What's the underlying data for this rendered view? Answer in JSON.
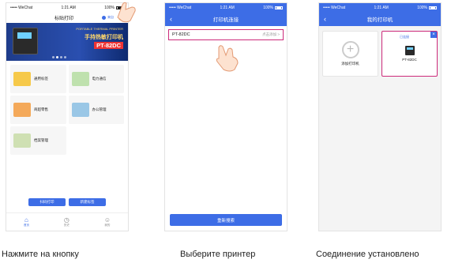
{
  "screen1": {
    "status": {
      "carrier": "••••• WeChat",
      "time": "1:21 AM",
      "battery": "100%"
    },
    "nav_title": "标贴打印",
    "nav_right": "来自",
    "banner": {
      "line1": "PORTABLE THERMAL PRINTER",
      "line2": "手持热敏打印机",
      "model": "PT-82DC"
    },
    "tiles": [
      {
        "label": "通用标签",
        "color": "#f6c94a"
      },
      {
        "label": "电力通信",
        "color": "#bfe1ae"
      },
      {
        "label": "商超零售",
        "color": "#f4a95a"
      },
      {
        "label": "办公管理",
        "color": "#9ac7e6"
      },
      {
        "label": "档案管理",
        "color": "#cfe0b3"
      }
    ],
    "quick": [
      "扫码打印",
      "新建标签"
    ],
    "tabs": [
      {
        "label": "首页",
        "icon": "house-icon"
      },
      {
        "label": "历史",
        "icon": "clock-icon"
      },
      {
        "label": "我的",
        "icon": "user-icon"
      }
    ]
  },
  "screen2": {
    "status": {
      "carrier": "••••• WeChat",
      "time": "1:21 AM",
      "battery": "100%"
    },
    "nav_title": "打印机连接",
    "printer_name": "PT-82DC",
    "printer_hint": "点击添加 >",
    "rescan": "重新搜索"
  },
  "screen3": {
    "status": {
      "carrier": "••••• WeChat",
      "time": "1:21 AM",
      "battery": "100%"
    },
    "nav_title": "我的打印机",
    "add_label": "添加打印机",
    "connected": "已连接",
    "printer_name": "PT-82DC"
  },
  "captions": [
    "Нажмите на кнопку",
    "Выберите принтер",
    "Соединение установлено"
  ],
  "colors": {
    "accent": "#3d6de6",
    "highlight": "#cc2a7a"
  }
}
